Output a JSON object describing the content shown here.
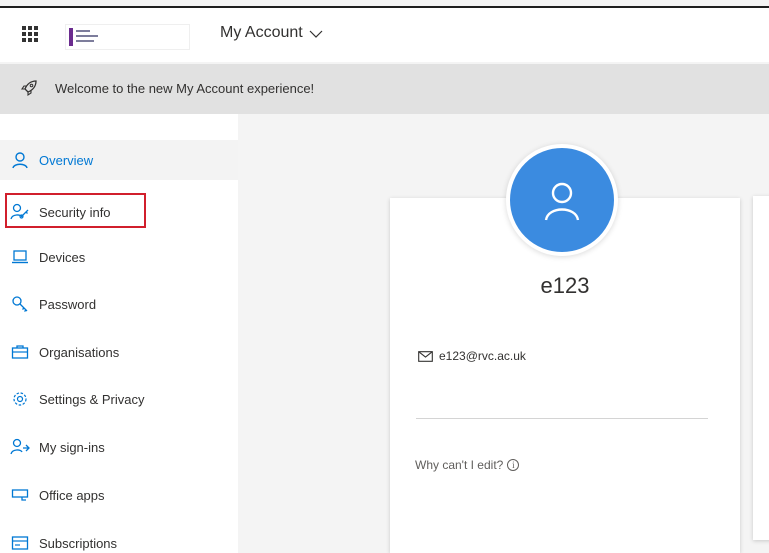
{
  "header": {
    "app_title": "My Account"
  },
  "banner": {
    "message": "Welcome to the new My Account experience!"
  },
  "sidebar": {
    "items": [
      {
        "label": "Overview",
        "icon": "person-icon",
        "active": true
      },
      {
        "label": "Security info",
        "icon": "security-info-icon",
        "active": false
      },
      {
        "label": "Devices",
        "icon": "laptop-icon",
        "active": false
      },
      {
        "label": "Password",
        "icon": "key-icon",
        "active": false
      },
      {
        "label": "Organisations",
        "icon": "briefcase-icon",
        "active": false
      },
      {
        "label": "Settings & Privacy",
        "icon": "gear-icon",
        "active": false
      },
      {
        "label": "My sign-ins",
        "icon": "sign-ins-icon",
        "active": false
      },
      {
        "label": "Office apps",
        "icon": "office-apps-icon",
        "active": false
      },
      {
        "label": "Subscriptions",
        "icon": "subscriptions-icon",
        "active": false
      }
    ]
  },
  "profile": {
    "username": "e123",
    "email": "e123@rvc.ac.uk",
    "why_edit": "Why can't I edit?"
  },
  "colors": {
    "accent": "#0078d4",
    "avatar": "#3b8be0",
    "highlight": "#d11f2c",
    "banner": "#e1e1e1"
  }
}
